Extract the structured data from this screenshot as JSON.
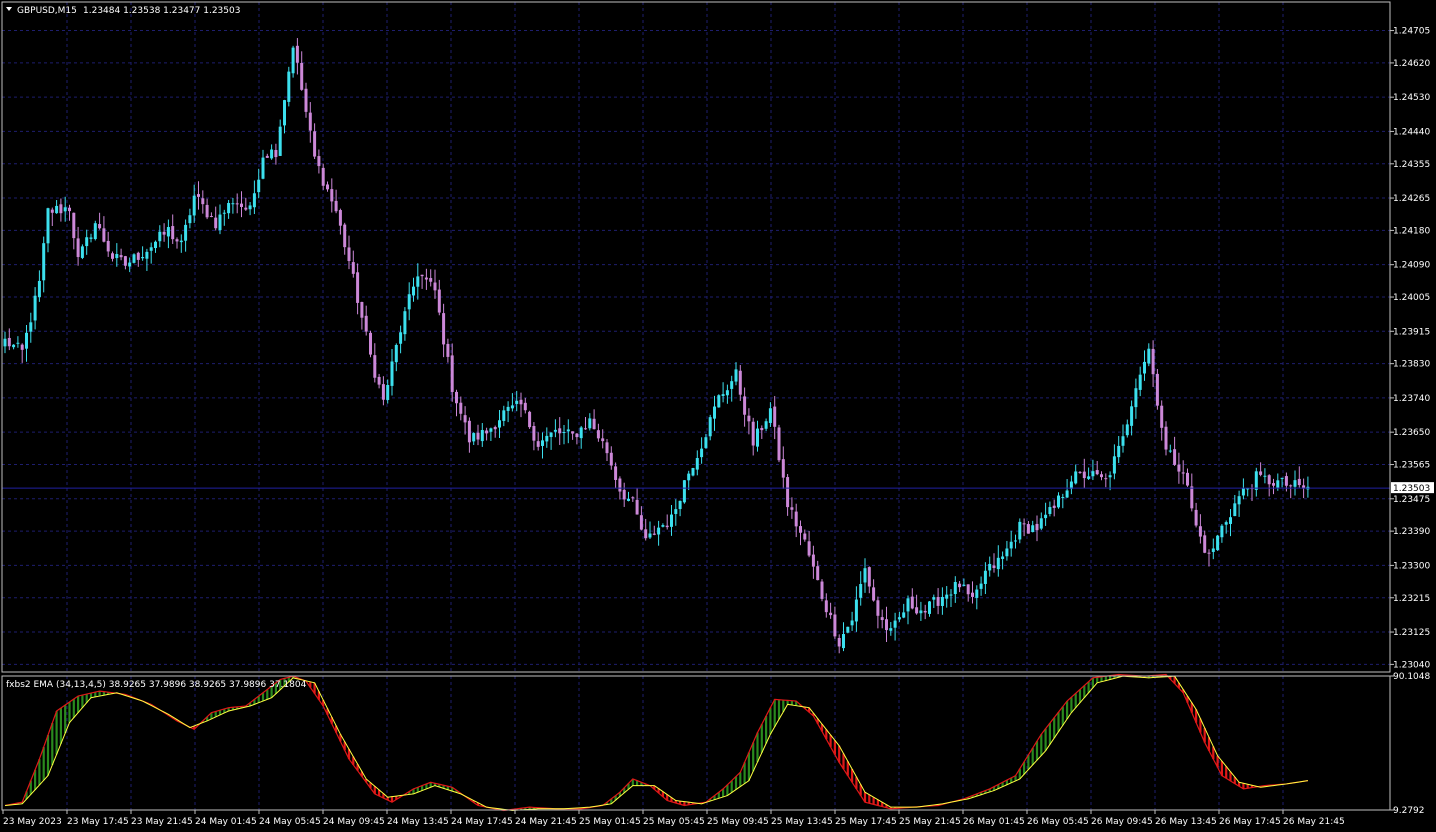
{
  "header": {
    "symbol": "GBPUSD,M15",
    "ohlc": "1.23484 1.23538 1.23477 1.23503",
    "indicator": "fxbs2 EMA (34,13,4,5) 38.9265 37.9896 38.9265 37.9896 37.1804"
  },
  "colors": {
    "background": "#000000",
    "grid": "#1e1e6e",
    "axis": "#c0c0c0",
    "bull": "#3ce0ee",
    "bear": "#cc88d8",
    "ind_up": "#2a8a1e",
    "ind_down": "#e01818",
    "signal": "#ffff40",
    "price_line": "#2020a0"
  },
  "chart_data": [
    {
      "type": "candlestick",
      "title": "GBPUSD,M15",
      "ylim": [
        1.2302,
        1.2478
      ],
      "y_ticks": [
        "1.24705",
        "1.24620",
        "1.24530",
        "1.24440",
        "1.24355",
        "1.24265",
        "1.24180",
        "1.24090",
        "1.24005",
        "1.23915",
        "1.23830",
        "1.23740",
        "1.23650",
        "1.23565",
        "1.23475",
        "1.23390",
        "1.23300",
        "1.23215",
        "1.23125",
        "1.23040"
      ],
      "current_price": "1.23503",
      "x_labels": [
        "23 May 2023",
        "23 May 17:45",
        "23 May 21:45",
        "24 May 01:45",
        "24 May 05:45",
        "24 May 09:45",
        "24 May 13:45",
        "24 May 17:45",
        "24 May 21:45",
        "25 May 01:45",
        "25 May 05:45",
        "25 May 09:45",
        "25 May 13:45",
        "25 May 17:45",
        "25 May 21:45",
        "26 May 01:45",
        "26 May 05:45",
        "26 May 09:45",
        "26 May 13:45",
        "26 May 17:45",
        "26 May 21:45"
      ],
      "close_path": [
        [
          0,
          1.2389
        ],
        [
          4,
          1.2386
        ],
        [
          8,
          1.2404
        ],
        [
          10,
          1.2423
        ],
        [
          15,
          1.2424
        ],
        [
          17,
          1.241
        ],
        [
          21,
          1.242
        ],
        [
          25,
          1.2411
        ],
        [
          28,
          1.2409
        ],
        [
          33,
          1.2413
        ],
        [
          38,
          1.2418
        ],
        [
          41,
          1.2414
        ],
        [
          44,
          1.2427
        ],
        [
          49,
          1.242
        ],
        [
          53,
          1.2426
        ],
        [
          57,
          1.2423
        ],
        [
          60,
          1.2438
        ],
        [
          63,
          1.2439
        ],
        [
          67,
          1.2467
        ],
        [
          72,
          1.2437
        ],
        [
          77,
          1.2423
        ],
        [
          80,
          1.241
        ],
        [
          85,
          1.2385
        ],
        [
          88,
          1.2373
        ],
        [
          92,
          1.2392
        ],
        [
          96,
          1.2407
        ],
        [
          100,
          1.2402
        ],
        [
          104,
          1.2377
        ],
        [
          108,
          1.2363
        ],
        [
          112,
          1.2365
        ],
        [
          116,
          1.237
        ],
        [
          120,
          1.2372
        ],
        [
          124,
          1.2362
        ],
        [
          128,
          1.2365
        ],
        [
          132,
          1.2364
        ],
        [
          136,
          1.2368
        ],
        [
          140,
          1.236
        ],
        [
          143,
          1.235
        ],
        [
          146,
          1.2346
        ],
        [
          149,
          1.2336
        ],
        [
          152,
          1.234
        ],
        [
          155,
          1.2342
        ],
        [
          158,
          1.2352
        ],
        [
          162,
          1.2362
        ],
        [
          166,
          1.2374
        ],
        [
          170,
          1.238
        ],
        [
          174,
          1.2362
        ],
        [
          178,
          1.2371
        ],
        [
          182,
          1.2346
        ],
        [
          186,
          1.2336
        ],
        [
          190,
          1.2322
        ],
        [
          194,
          1.231
        ],
        [
          197,
          1.2316
        ],
        [
          200,
          1.2329
        ],
        [
          203,
          1.2317
        ],
        [
          206,
          1.2312
        ],
        [
          210,
          1.232
        ],
        [
          214,
          1.2318
        ],
        [
          218,
          1.2322
        ],
        [
          222,
          1.2325
        ],
        [
          225,
          1.232
        ],
        [
          228,
          1.2328
        ],
        [
          232,
          1.2332
        ],
        [
          236,
          1.234
        ],
        [
          240,
          1.234
        ],
        [
          244,
          1.2345
        ],
        [
          248,
          1.2353
        ],
        [
          252,
          1.2354
        ],
        [
          256,
          1.2352
        ],
        [
          260,
          1.2363
        ],
        [
          263,
          1.2378
        ],
        [
          266,
          1.2387
        ],
        [
          270,
          1.236
        ],
        [
          274,
          1.2355
        ],
        [
          277,
          1.234
        ],
        [
          280,
          1.2332
        ],
        [
          283,
          1.234
        ],
        [
          287,
          1.2348
        ],
        [
          291,
          1.2353
        ],
        [
          295,
          1.2352
        ],
        [
          299,
          1.2351
        ],
        [
          303,
          1.235
        ]
      ]
    },
    {
      "type": "line",
      "title": "fxbs2 EMA (34,13,4,5)",
      "ylim": [
        9.2792,
        90.1048
      ],
      "y_ticks": [
        "90.1048",
        "9.2792"
      ],
      "main_path": [
        [
          0,
          12
        ],
        [
          4,
          14
        ],
        [
          8,
          40
        ],
        [
          12,
          69
        ],
        [
          17,
          78
        ],
        [
          22,
          81
        ],
        [
          28,
          79
        ],
        [
          34,
          73
        ],
        [
          40,
          63
        ],
        [
          44,
          58
        ],
        [
          48,
          68
        ],
        [
          52,
          71
        ],
        [
          56,
          72
        ],
        [
          60,
          80
        ],
        [
          64,
          88
        ],
        [
          67,
          90
        ],
        [
          70,
          87
        ],
        [
          74,
          72
        ],
        [
          80,
          40
        ],
        [
          86,
          19
        ],
        [
          90,
          14
        ],
        [
          95,
          22
        ],
        [
          99,
          26
        ],
        [
          104,
          23
        ],
        [
          110,
          12
        ],
        [
          116,
          9
        ],
        [
          122,
          11
        ],
        [
          128,
          10
        ],
        [
          134,
          10
        ],
        [
          139,
          12
        ],
        [
          143,
          20
        ],
        [
          146,
          28
        ],
        [
          150,
          24
        ],
        [
          154,
          15
        ],
        [
          158,
          12
        ],
        [
          163,
          14
        ],
        [
          167,
          22
        ],
        [
          171,
          32
        ],
        [
          175,
          56
        ],
        [
          179,
          76
        ],
        [
          184,
          75
        ],
        [
          188,
          66
        ],
        [
          194,
          38
        ],
        [
          200,
          14
        ],
        [
          206,
          10
        ],
        [
          211,
          11
        ],
        [
          217,
          12
        ],
        [
          223,
          16
        ],
        [
          229,
          22
        ],
        [
          235,
          30
        ],
        [
          241,
          55
        ],
        [
          247,
          75
        ],
        [
          253,
          89
        ],
        [
          259,
          91
        ],
        [
          265,
          90
        ],
        [
          270,
          91
        ],
        [
          274,
          80
        ],
        [
          279,
          50
        ],
        [
          283,
          30
        ],
        [
          288,
          22
        ],
        [
          293,
          24
        ],
        [
          298,
          25
        ],
        [
          303,
          27
        ]
      ],
      "signal_path": [
        [
          0,
          12
        ],
        [
          4,
          13
        ],
        [
          10,
          30
        ],
        [
          15,
          62
        ],
        [
          20,
          77
        ],
        [
          26,
          80
        ],
        [
          32,
          75
        ],
        [
          38,
          67
        ],
        [
          43,
          59
        ],
        [
          47,
          63
        ],
        [
          52,
          69
        ],
        [
          57,
          72
        ],
        [
          62,
          77
        ],
        [
          67,
          89
        ],
        [
          72,
          86
        ],
        [
          78,
          55
        ],
        [
          84,
          28
        ],
        [
          89,
          17
        ],
        [
          95,
          19
        ],
        [
          100,
          24
        ],
        [
          106,
          19
        ],
        [
          112,
          11
        ],
        [
          118,
          9
        ],
        [
          124,
          10
        ],
        [
          130,
          10
        ],
        [
          136,
          11
        ],
        [
          141,
          13
        ],
        [
          146,
          24
        ],
        [
          151,
          24
        ],
        [
          156,
          15
        ],
        [
          162,
          13
        ],
        [
          168,
          18
        ],
        [
          173,
          27
        ],
        [
          178,
          55
        ],
        [
          182,
          73
        ],
        [
          187,
          71
        ],
        [
          194,
          48
        ],
        [
          200,
          20
        ],
        [
          206,
          11
        ],
        [
          212,
          11
        ],
        [
          218,
          13
        ],
        [
          224,
          16
        ],
        [
          230,
          21
        ],
        [
          236,
          28
        ],
        [
          242,
          45
        ],
        [
          248,
          68
        ],
        [
          254,
          86
        ],
        [
          260,
          90
        ],
        [
          266,
          89
        ],
        [
          272,
          90
        ],
        [
          277,
          70
        ],
        [
          282,
          42
        ],
        [
          287,
          26
        ],
        [
          292,
          23
        ],
        [
          298,
          25
        ],
        [
          303,
          27
        ]
      ]
    }
  ]
}
